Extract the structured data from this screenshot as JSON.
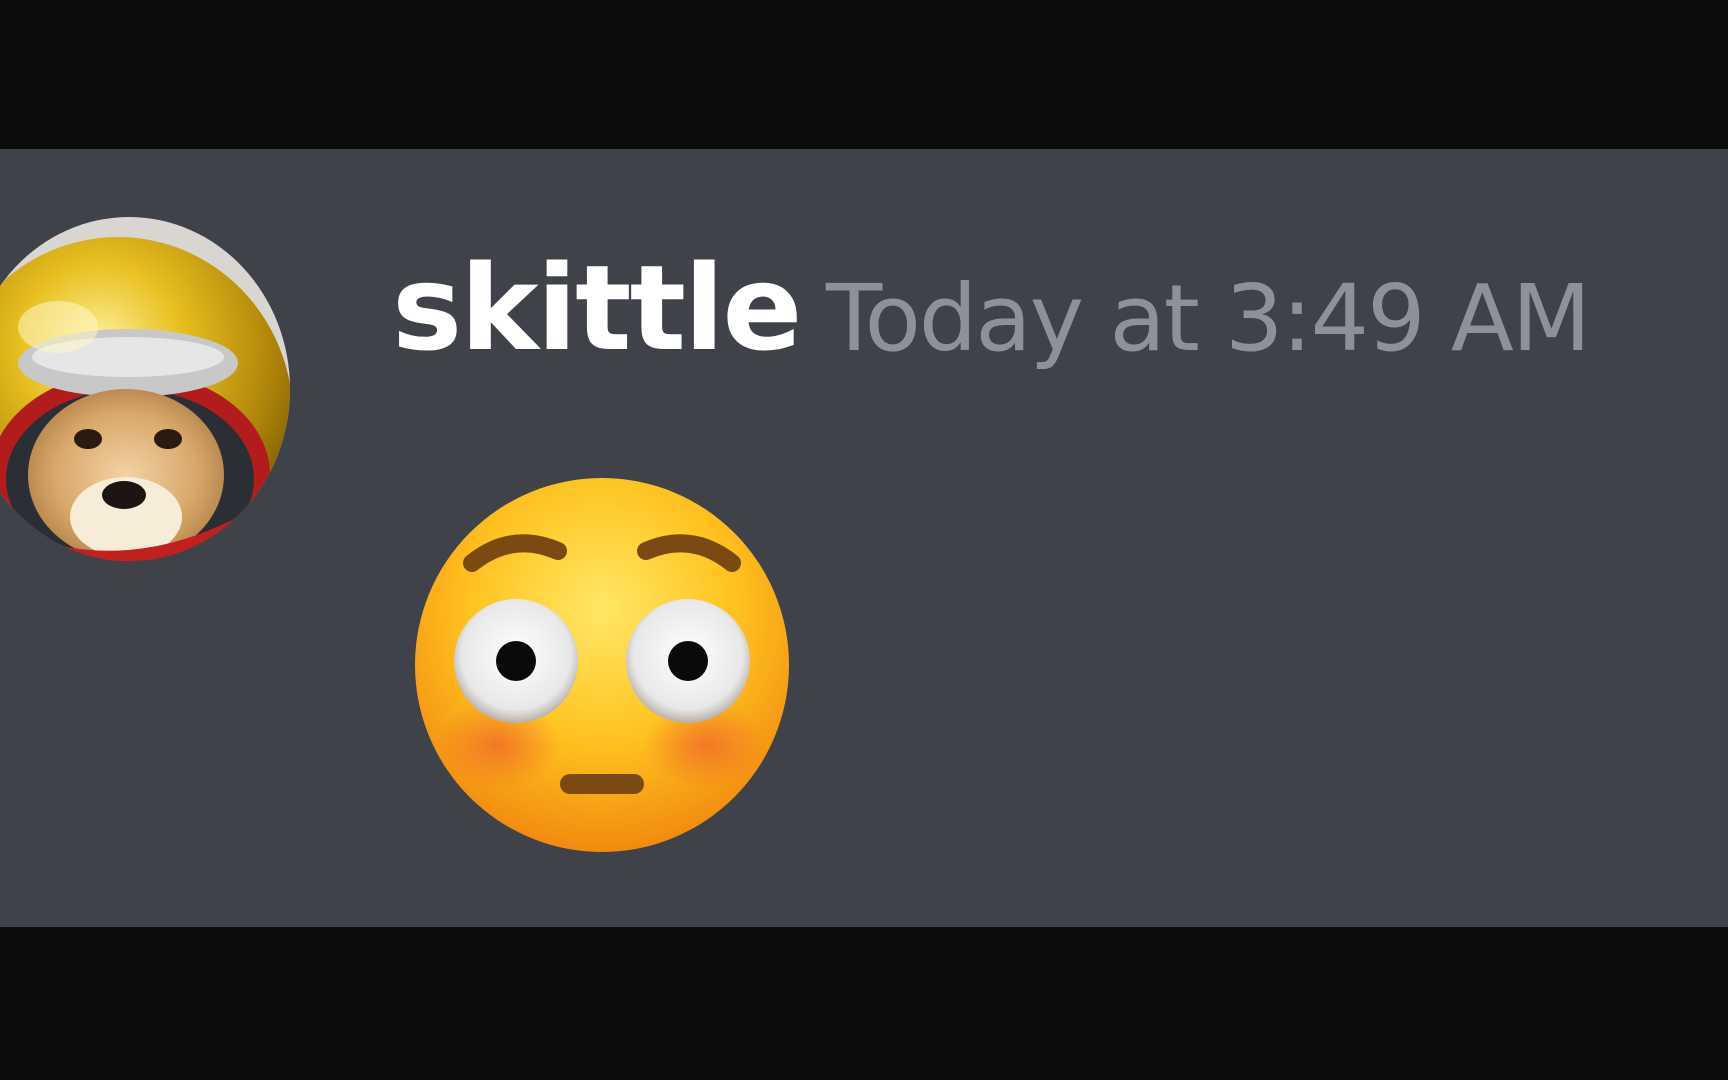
{
  "message": {
    "username": "skittle",
    "timestamp": "Today at 3:49 AM",
    "avatar_icon": "shiba-astronaut-helmet-avatar",
    "emoji_icon": "flushed-face-emoji"
  },
  "colors": {
    "background": "#0d0d0e",
    "message_bg": "#404249",
    "username": "#ffffff",
    "timestamp": "#8d9199"
  }
}
